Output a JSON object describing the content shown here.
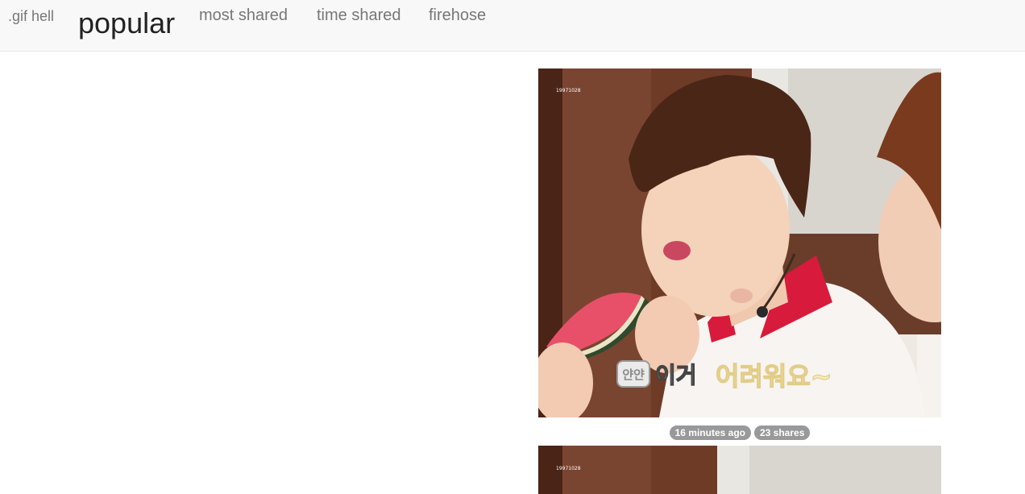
{
  "navbar": {
    "brand": ".gif hell",
    "active_item": "popular",
    "items": [
      "most shared",
      "time shared",
      "firehose"
    ]
  },
  "feed": {
    "posts": [
      {
        "watermark": "19971028",
        "caption_bubble": "얀얀",
        "caption_main": "이거",
        "caption_highlight": "어려워요~",
        "time_ago": "16 minutes ago",
        "shares": "23 shares"
      },
      {
        "watermark": "19971028"
      }
    ]
  },
  "colors": {
    "navbar_bg": "#f8f8f8",
    "nav_text": "#777777",
    "active_text": "#222222",
    "badge_bg": "#999999"
  }
}
